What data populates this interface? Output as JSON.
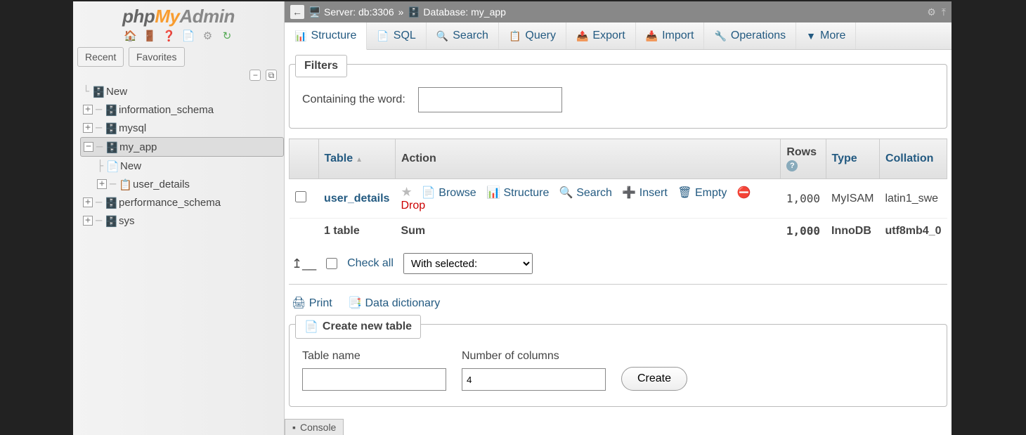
{
  "logo": {
    "p1": "php",
    "p2": "My",
    "p3": "Admin"
  },
  "recent_favorites": {
    "recent": "Recent",
    "favorites": "Favorites"
  },
  "tree": {
    "new": "New",
    "items": [
      {
        "label": "information_schema"
      },
      {
        "label": "mysql"
      },
      {
        "label": "my_app",
        "expanded": true
      },
      {
        "label": "performance_schema"
      },
      {
        "label": "sys"
      }
    ],
    "my_app_children": {
      "new": "New",
      "table": "user_details"
    }
  },
  "breadcrumb": {
    "server_label": "Server:",
    "server_value": "db:3306",
    "database_label": "Database:",
    "database_value": "my_app"
  },
  "tabs": {
    "structure": "Structure",
    "sql": "SQL",
    "search": "Search",
    "query": "Query",
    "export": "Export",
    "import": "Import",
    "operations": "Operations",
    "more": "More"
  },
  "filters": {
    "legend": "Filters",
    "containing": "Containing the word:"
  },
  "table": {
    "headers": {
      "table": "Table",
      "action": "Action",
      "rows": "Rows",
      "type": "Type",
      "collation": "Collation"
    },
    "row": {
      "name": "user_details",
      "browse": "Browse",
      "structure": "Structure",
      "search": "Search",
      "insert": "Insert",
      "empty": "Empty",
      "drop": "Drop",
      "rows": "1,000",
      "type": "MyISAM",
      "collation": "latin1_swe"
    },
    "sum": {
      "label": "1 table",
      "sum": "Sum",
      "rows": "1,000",
      "type": "InnoDB",
      "collation": "utf8mb4_0"
    }
  },
  "checkall": {
    "label": "Check all",
    "with_selected": "With selected:"
  },
  "links": {
    "print": "Print",
    "data_dictionary": "Data dictionary"
  },
  "create": {
    "legend": "Create new table",
    "name_label": "Table name",
    "cols_label": "Number of columns",
    "cols_value": "4",
    "button": "Create"
  },
  "console": "Console"
}
